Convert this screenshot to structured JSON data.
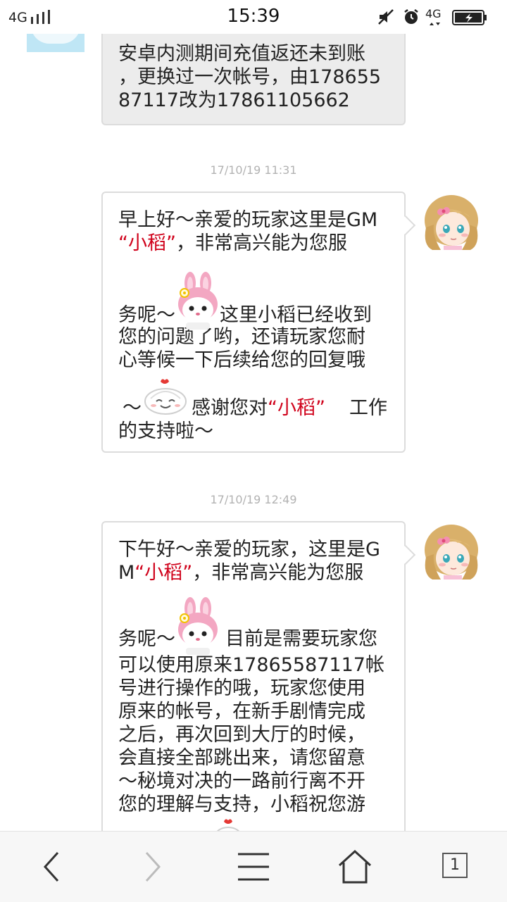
{
  "status_bar": {
    "signal_label": "4G",
    "time": "15:39",
    "right_network_label": "4G"
  },
  "messages": {
    "user_msg": {
      "lines": [
        "安卓内测期间充值返还未到账",
        "，更换过一次帐号，由178655",
        "87117改为17861105662"
      ]
    },
    "timestamp_1": "17/10/19 11:31",
    "gm_msg_1": {
      "l1": "早上好～亲爱的玩家这里是GM",
      "l2_q": "“小稻”",
      "l2_rest": "，非常高兴能为您服",
      "l3_pre": "务呢～",
      "l3_post": "这里小稻已经收到",
      "l4": "您的问题了哟，还请玩家您耐",
      "l5": "心等候一下后续给您的回复哦",
      "l6_pre": "～",
      "l6_mid": "感谢您对",
      "l6_q": "“小稻”",
      "l6_post": "工作",
      "l7": "的支持啦～"
    },
    "timestamp_2": "17/10/19 12:49",
    "gm_msg_2": {
      "l1": "下午好～亲爱的玩家，这里是G",
      "l2_pre": "M",
      "l2_q": "“小稻”",
      "l2_rest": "，非常高兴能为您服",
      "l3_pre": "务呢～",
      "l3_post": "目前是需要玩家您",
      "l4": "可以使用原来17865587117帐",
      "l5": "号进行操作的哦，玩家您使用",
      "l6": "原来的帐号，在新手剧情完成",
      "l7": "之后，再次回到大厅的时候，",
      "l8": "会直接全部跳出来，请您留意",
      "l9": "～秘境对决的一路前行离不开",
      "l10": "您的理解与支持，小稻祝您游"
    }
  },
  "bottom_nav": {
    "tab_count": "1",
    "icons": [
      "back-arrow-icon",
      "forward-arrow-icon",
      "menu-icon",
      "home-icon",
      "tabs-icon"
    ]
  },
  "colors": {
    "highlight_red": "#d0021b",
    "user_bubble_bg": "#ececec",
    "timestamp_gray": "#b2b2b2"
  }
}
